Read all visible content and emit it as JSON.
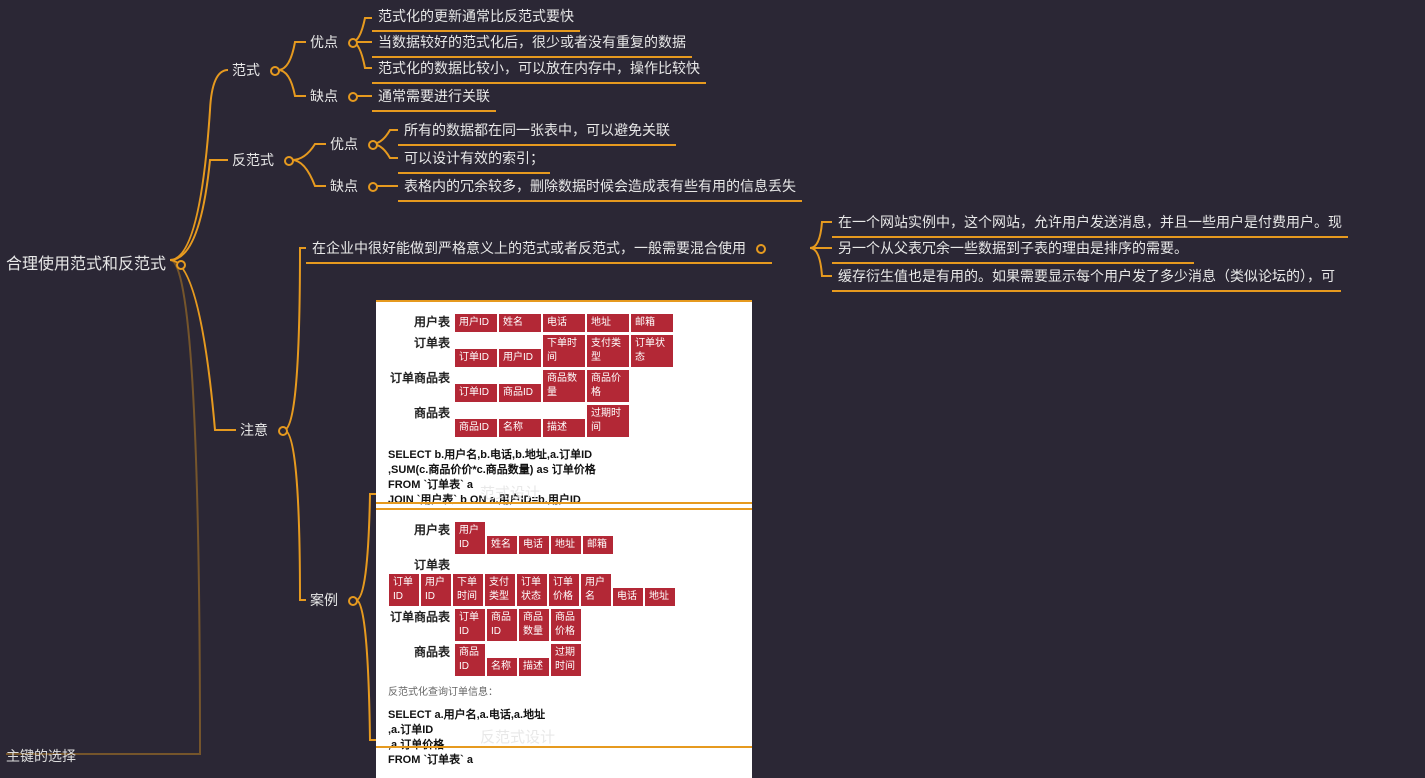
{
  "root": "合理使用范式和反范式",
  "fanshi": {
    "label": "范式",
    "youdian": {
      "label": "优点",
      "items": [
        "范式化的更新通常比反范式要快",
        "当数据较好的范式化后，很少或者没有重复的数据",
        "范式化的数据比较小，可以放在内存中，操作比较快"
      ]
    },
    "quedian": {
      "label": "缺点",
      "items": [
        "通常需要进行关联"
      ]
    }
  },
  "fanfanshi": {
    "label": "反范式",
    "youdian": {
      "label": "优点",
      "items": [
        "所有的数据都在同一张表中，可以避免关联",
        "可以设计有效的索引；"
      ]
    },
    "quedian": {
      "label": "缺点",
      "items": [
        "表格内的冗余较多，删除数据时候会造成表有些有用的信息丢失"
      ]
    }
  },
  "zhuyi": {
    "label": "注意",
    "mix": "在企业中很好能做到严格意义上的范式或者反范式，一般需要混合使用",
    "mix_children": [
      "在一个网站实例中，这个网站，允许用户发送消息，并且一些用户是付费用户。现",
      "另一个从父表冗余一些数据到子表的理由是排序的需要。",
      "缓存衍生值也是有用的。如果需要显示每个用户发了多少消息（类似论坛的），可"
    ],
    "anli": "案例",
    "caption1": "范式设计",
    "caption2": "反范式设计"
  },
  "img1": {
    "rows": [
      {
        "label": "用户表",
        "cells": [
          "用户ID",
          "姓名",
          "电话",
          "地址",
          "邮箱"
        ]
      },
      {
        "label": "订单表",
        "cells": [
          "订单ID",
          "用户ID",
          "下单时间",
          "支付类型",
          "订单状态"
        ]
      },
      {
        "label": "订单商品表",
        "cells": [
          "订单ID",
          "商品ID",
          "商品数量",
          "商品价格"
        ]
      },
      {
        "label": "商品表",
        "cells": [
          "商品ID",
          "名称",
          "描述",
          "过期时间"
        ]
      }
    ],
    "sql": "SELECT b.用户名,b.电话,b.地址,a.订单ID\n        ,SUM(c.商品价价*c.商品数量) as 订单价格\nFROM `订单表` a\nJOIN `用户表` b ON a.用户ID=b.用户ID\nJOIN `订单商品表` c ON c.订单ID=b.订单ID\nGROUP BY b.用户名,b.电话,b.地址,a.订单ID"
  },
  "img2": {
    "rows": [
      {
        "label": "用户表",
        "cells": [
          "用户ID",
          "姓名",
          "电话",
          "地址",
          "邮箱"
        ]
      },
      {
        "label": "订单表",
        "cells": [
          "订单ID",
          "用户ID",
          "下单时间",
          "支付类型",
          "订单状态",
          "订单价格",
          "用户名",
          "电话",
          "地址"
        ]
      },
      {
        "label": "订单商品表",
        "cells": [
          "订单ID",
          "商品ID",
          "商品数量",
          "商品价格"
        ]
      },
      {
        "label": "商品表",
        "cells": [
          "商品ID",
          "名称",
          "描述",
          "过期时间"
        ]
      }
    ],
    "note": "反范式化查询订单信息：",
    "sql": "SELECT a.用户名,a.电话,a.地址\n,a.订单ID\n,a.订单价格\nFROM `订单表` a"
  },
  "bottom_cut": "主键的选择"
}
